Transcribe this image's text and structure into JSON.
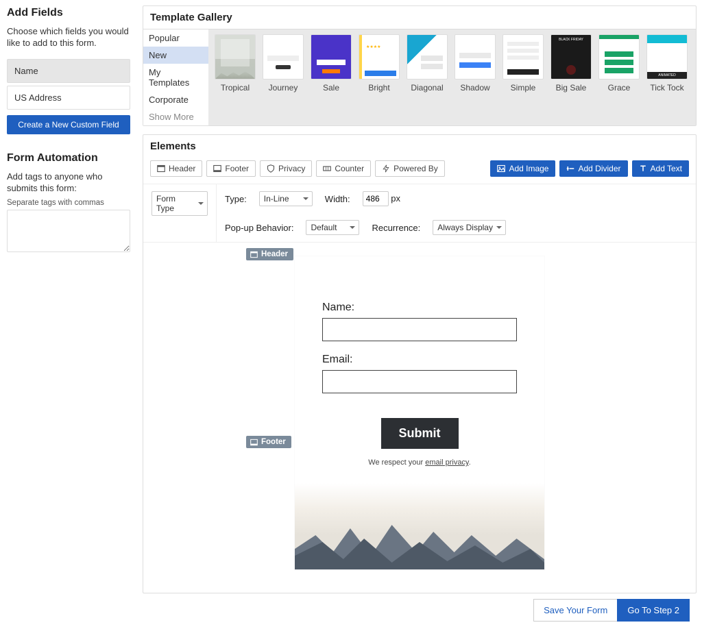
{
  "sidebar": {
    "add_fields_title": "Add Fields",
    "add_fields_help": "Choose which fields you would like to add to this form.",
    "fields": [
      {
        "label": "Name",
        "selected": true
      },
      {
        "label": "US Address",
        "selected": false
      }
    ],
    "create_field_btn": "Create a New Custom Field",
    "automation_title": "Form Automation",
    "automation_help": "Add tags to anyone who submits this form:",
    "tags_hint": "Separate tags with commas"
  },
  "gallery": {
    "title": "Template Gallery",
    "nav": [
      "Popular",
      "New",
      "My Templates",
      "Corporate",
      "Show More"
    ],
    "nav_active": "New",
    "templates": [
      {
        "name": "Tropical",
        "cls": "mountain"
      },
      {
        "name": "Journey",
        "cls": "journey"
      },
      {
        "name": "Sale",
        "cls": "sale"
      },
      {
        "name": "Bright",
        "cls": "bright"
      },
      {
        "name": "Diagonal",
        "cls": "diagonal"
      },
      {
        "name": "Shadow",
        "cls": "shadow"
      },
      {
        "name": "Simple",
        "cls": "simple"
      },
      {
        "name": "Big Sale",
        "cls": "bigsale"
      },
      {
        "name": "Grace",
        "cls": "grace"
      },
      {
        "name": "Tick Tock",
        "cls": "ticktock"
      }
    ]
  },
  "elements": {
    "title": "Elements",
    "tools_gray": [
      {
        "label": "Header",
        "icon": "header"
      },
      {
        "label": "Footer",
        "icon": "footer"
      },
      {
        "label": "Privacy",
        "icon": "shield"
      },
      {
        "label": "Counter",
        "icon": "counter"
      },
      {
        "label": "Powered By",
        "icon": "bolt"
      }
    ],
    "tools_blue": [
      {
        "label": "Add Image",
        "icon": "image"
      },
      {
        "label": "Add Divider",
        "icon": "divider"
      },
      {
        "label": "Add Text",
        "icon": "text"
      }
    ],
    "settings": {
      "form_type_label": "Form Type",
      "type_label": "Type:",
      "type_value": "In-Line",
      "width_label": "Width:",
      "width_value": "486",
      "width_unit": "px",
      "popup_label": "Pop-up Behavior:",
      "popup_value": "Default",
      "recurrence_label": "Recurrence:",
      "recurrence_value": "Always Display"
    }
  },
  "form_preview": {
    "header_tag": "Header",
    "footer_tag": "Footer",
    "name_label": "Name:",
    "email_label": "Email:",
    "submit_label": "Submit",
    "privacy_prefix": "We respect your ",
    "privacy_link": "email privacy",
    "privacy_suffix": "."
  },
  "actions": {
    "save": "Save Your Form",
    "next": "Go To Step 2"
  }
}
